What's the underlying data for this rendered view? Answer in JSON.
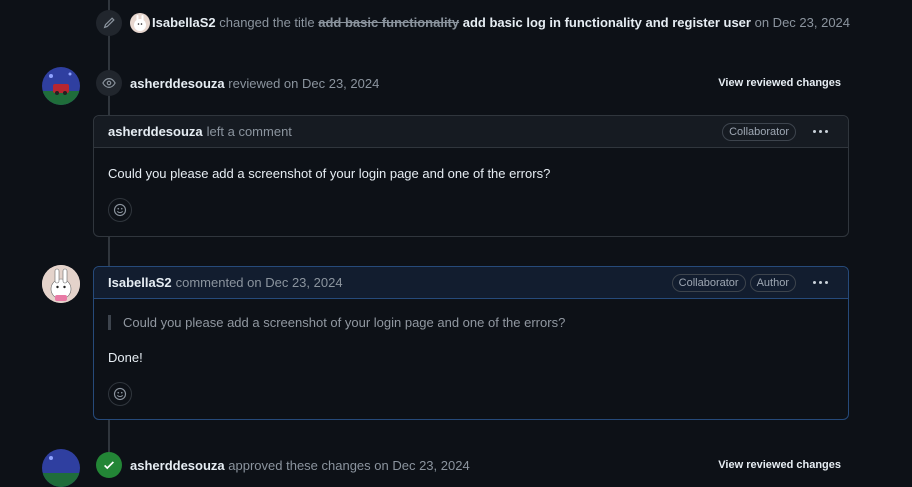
{
  "rename_event": {
    "user": "IsabellaS2",
    "action": "changed the title",
    "old_title": "add basic functionality",
    "new_title": "add basic log in functionality and register user",
    "date": "on Dec 23, 2024"
  },
  "review_event": {
    "user": "asherddesouza",
    "action": "reviewed on Dec 23, 2024",
    "view_link": "View reviewed changes"
  },
  "review_comment": {
    "user": "asherddesouza",
    "action": "left a comment",
    "label": "Collaborator",
    "body": "Could you please add a screenshot of your login page and one of the errors?"
  },
  "reply_comment": {
    "user": "IsabellaS2",
    "action": "commented on Dec 23, 2024",
    "labels": [
      "Collaborator",
      "Author"
    ],
    "quote": "Could you please add a screenshot of your login page and one of the errors?",
    "body": "Done!"
  },
  "approve_event": {
    "user": "asherddesouza",
    "action": "approved these changes on Dec 23, 2024",
    "view_link": "View reviewed changes"
  },
  "icons": {
    "rename": "pencil-icon",
    "review": "eye-icon",
    "approve": "check-icon",
    "reaction": "smiley-icon",
    "menu": "kebab-icon"
  },
  "colors": {
    "background": "#0d1117",
    "border": "#30363d",
    "approve_green": "#238636",
    "author_border": "#264a7a"
  }
}
